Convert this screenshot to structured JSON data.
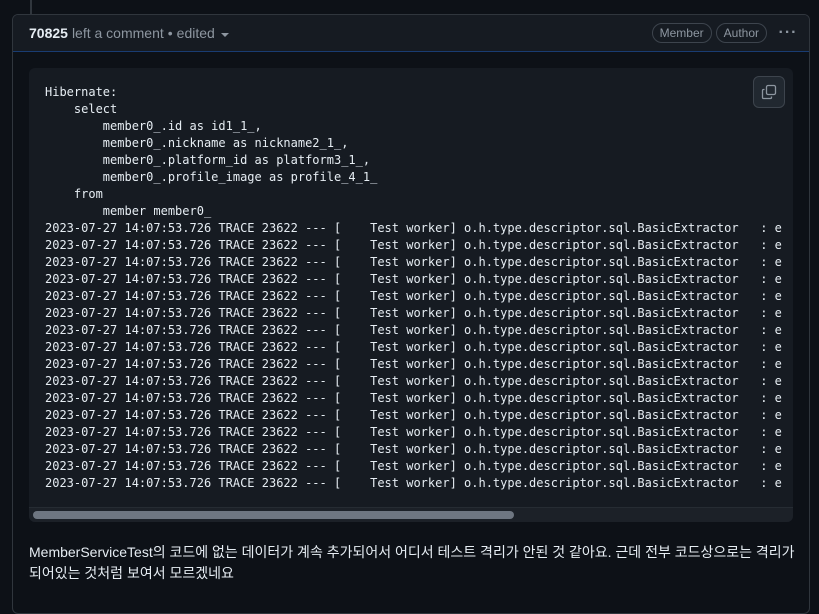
{
  "comment": {
    "author": "70825",
    "action": "left a comment",
    "separator": "•",
    "edited_label": "edited",
    "badges": [
      "Member",
      "Author"
    ],
    "more_label": "···"
  },
  "code": {
    "lines": [
      "Hibernate: ",
      "    select",
      "        member0_.id as id1_1_,",
      "        member0_.nickname as nickname2_1_,",
      "        member0_.platform_id as platform3_1_,",
      "        member0_.profile_image as profile_4_1_ ",
      "    from",
      "        member member0_",
      "2023-07-27 14:07:53.726 TRACE 23622 --- [    Test worker] o.h.type.descriptor.sql.BasicExtractor   : e",
      "2023-07-27 14:07:53.726 TRACE 23622 --- [    Test worker] o.h.type.descriptor.sql.BasicExtractor   : e",
      "2023-07-27 14:07:53.726 TRACE 23622 --- [    Test worker] o.h.type.descriptor.sql.BasicExtractor   : e",
      "2023-07-27 14:07:53.726 TRACE 23622 --- [    Test worker] o.h.type.descriptor.sql.BasicExtractor   : e",
      "2023-07-27 14:07:53.726 TRACE 23622 --- [    Test worker] o.h.type.descriptor.sql.BasicExtractor   : e",
      "2023-07-27 14:07:53.726 TRACE 23622 --- [    Test worker] o.h.type.descriptor.sql.BasicExtractor   : e",
      "2023-07-27 14:07:53.726 TRACE 23622 --- [    Test worker] o.h.type.descriptor.sql.BasicExtractor   : e",
      "2023-07-27 14:07:53.726 TRACE 23622 --- [    Test worker] o.h.type.descriptor.sql.BasicExtractor   : e",
      "2023-07-27 14:07:53.726 TRACE 23622 --- [    Test worker] o.h.type.descriptor.sql.BasicExtractor   : e",
      "2023-07-27 14:07:53.726 TRACE 23622 --- [    Test worker] o.h.type.descriptor.sql.BasicExtractor   : e",
      "2023-07-27 14:07:53.726 TRACE 23622 --- [    Test worker] o.h.type.descriptor.sql.BasicExtractor   : e",
      "2023-07-27 14:07:53.726 TRACE 23622 --- [    Test worker] o.h.type.descriptor.sql.BasicExtractor   : e",
      "2023-07-27 14:07:53.726 TRACE 23622 --- [    Test worker] o.h.type.descriptor.sql.BasicExtractor   : e",
      "2023-07-27 14:07:53.726 TRACE 23622 --- [    Test worker] o.h.type.descriptor.sql.BasicExtractor   : e",
      "2023-07-27 14:07:53.726 TRACE 23622 --- [    Test worker] o.h.type.descriptor.sql.BasicExtractor   : e",
      "2023-07-27 14:07:53.726 TRACE 23622 --- [    Test worker] o.h.type.descriptor.sql.BasicExtractor   : e"
    ],
    "copy_icon": "copy-icon",
    "scroll_position": 0.0
  },
  "body_text": "MemberServiceTest의 코드에 없는 데이터가 계속 추가되어서 어디서 테스트 격리가 안된 것 같아요. 근데 전부 코드상으로는 격리가 되어있는 것처럼 보여서 모르겠네요"
}
